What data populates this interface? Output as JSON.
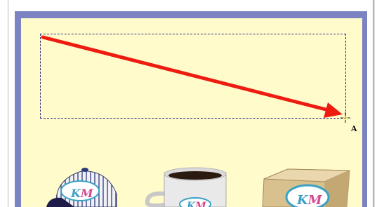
{
  "marker": {
    "label": "A"
  },
  "logo": {
    "text": "KM"
  },
  "colors": {
    "frame": "#7b83c2",
    "panel": "#fffbcb",
    "arrow": "#ee1b10",
    "logo_oval": "#3aa1c6",
    "logo_pink": "#d44a8e"
  },
  "products": [
    {
      "name": "cap"
    },
    {
      "name": "mug"
    },
    {
      "name": "box"
    }
  ]
}
